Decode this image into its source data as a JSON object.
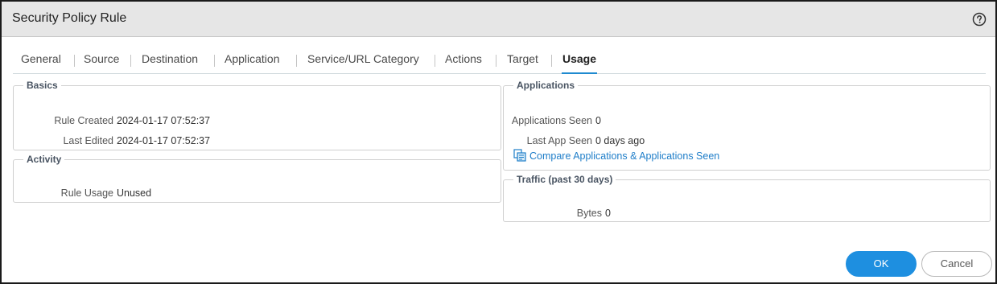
{
  "dialog": {
    "title": "Security Policy Rule",
    "help_icon": "question-circle-icon"
  },
  "tabs": [
    {
      "label": "General",
      "active": false
    },
    {
      "label": "Source",
      "active": false
    },
    {
      "label": "Destination",
      "active": false
    },
    {
      "label": "Application",
      "active": false
    },
    {
      "label": "Service/URL Category",
      "active": false
    },
    {
      "label": "Actions",
      "active": false
    },
    {
      "label": "Target",
      "active": false
    },
    {
      "label": "Usage",
      "active": true
    }
  ],
  "basics": {
    "legend": "Basics",
    "rule_created_label": "Rule Created",
    "rule_created_value": "2024-01-17 07:52:37",
    "last_edited_label": "Last Edited",
    "last_edited_value": "2024-01-17 07:52:37"
  },
  "activity": {
    "legend": "Activity",
    "rule_usage_label": "Rule Usage",
    "rule_usage_value": "Unused"
  },
  "applications": {
    "legend": "Applications",
    "apps_seen_label": "Applications Seen",
    "apps_seen_value": "0",
    "last_app_seen_label": "Last App Seen",
    "last_app_seen_value": "0 days ago",
    "compare_link": "Compare Applications & Applications Seen",
    "compare_icon": "compare-copy-icon"
  },
  "traffic": {
    "legend": "Traffic (past 30 days)",
    "bytes_label": "Bytes",
    "bytes_value": "0"
  },
  "buttons": {
    "ok": "OK",
    "cancel": "Cancel"
  },
  "colors": {
    "accent": "#1e8fe0",
    "link": "#1f7ec9",
    "titlebar": "#e6e6e6"
  }
}
